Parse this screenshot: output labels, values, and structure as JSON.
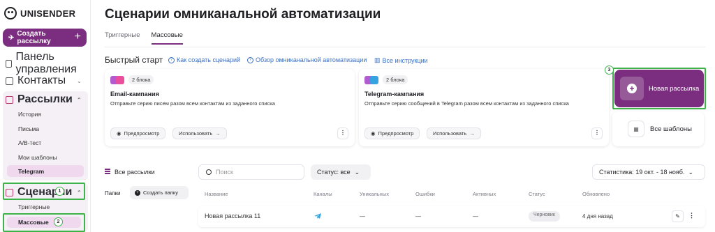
{
  "app": {
    "brand": "UNISENDER"
  },
  "sidebar": {
    "create_label": "Создать рассылку",
    "items": [
      {
        "label": "Панель управления"
      },
      {
        "label": "Контакты"
      },
      {
        "label": "Рассылки"
      },
      {
        "label": "Сценарии"
      }
    ],
    "mail_sub": [
      "История",
      "Письма",
      "A/B-тест",
      "Мои шаблоны"
    ],
    "telegram": "Telegram",
    "scenario_sub": [
      "Триггерные"
    ],
    "massovye": "Массовые",
    "badges": [
      "1",
      "2",
      "3"
    ]
  },
  "main": {
    "title": "Сценарии омниканальной автоматизации",
    "tabs": [
      "Триггерные",
      "Массовые"
    ],
    "quick_start": "Быстрый старт",
    "links": [
      "Как создать сценарий",
      "Обзор омниканальной автоматизации",
      "Все инструкции"
    ]
  },
  "cards": [
    {
      "chip": "2 блока",
      "title": "Email-кампания",
      "desc": "Отправьте серию писем разом всем контактам из заданного списка",
      "preview": "Предпросмотр",
      "use": "Использовать"
    },
    {
      "chip": "2 блока",
      "title": "Telegram-кампания",
      "desc": "Отправьте серию сообщений в Telegram разом всем контактам из заданного списка",
      "preview": "Предпросмотр",
      "use": "Использовать"
    }
  ],
  "new_mailing": "Новая рассылка",
  "all_templates": "Все шаблоны",
  "list": {
    "all_mail": "Все рассылки",
    "folders": "Папки",
    "create_folder": "Создать папку",
    "search_placeholder": "Поиск",
    "status_filter": "Статус: все",
    "stats": "Статистика: 19 окт. - 18 нояб.",
    "columns": [
      "Название",
      "Каналы",
      "Уникальных",
      "Ошибки",
      "Активных",
      "Статус",
      "Обновлено"
    ],
    "rows": [
      {
        "name": "Новая рассылка 11",
        "unique": "—",
        "errors": "—",
        "active": "—",
        "status": "Черновик",
        "updated": "4 дня назад"
      }
    ]
  },
  "colors": {
    "accent": "#7b2d7f",
    "highlight": "#3db34a",
    "link": "#3a6fc4"
  }
}
